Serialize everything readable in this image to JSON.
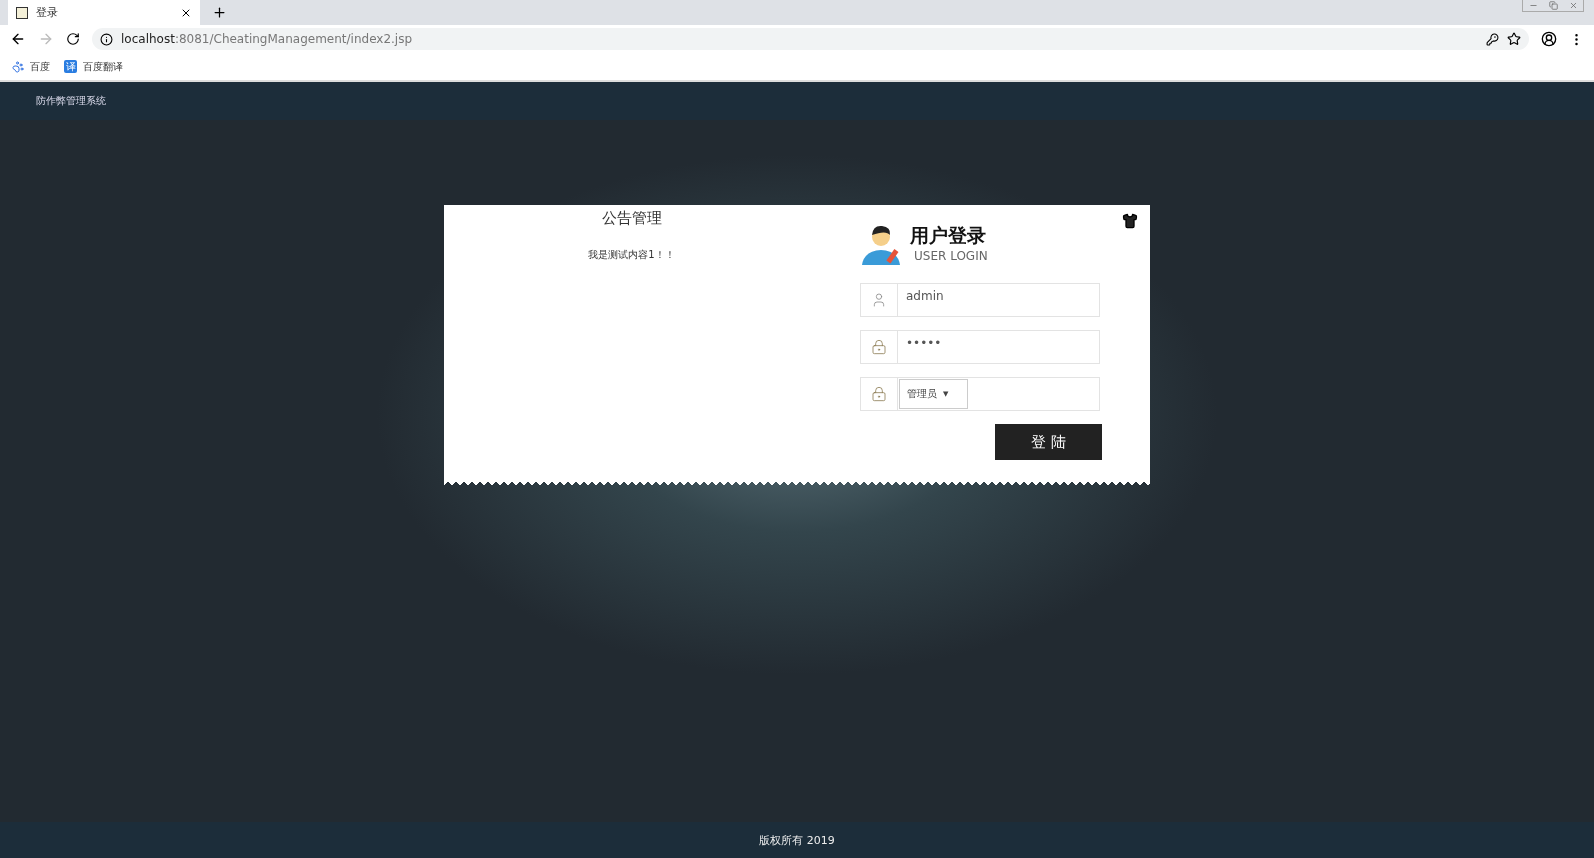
{
  "browser": {
    "tab": {
      "title": "登录"
    },
    "url": {
      "host": "localhost",
      "rest": ":8081/CheatingManagement/index2.jsp"
    },
    "bookmarks": [
      {
        "label": "百度",
        "kind": "paw"
      },
      {
        "label": "百度翻译",
        "kind": "translate",
        "badge": "译"
      }
    ]
  },
  "header": {
    "title": "防作弊管理系统"
  },
  "notice": {
    "title": "公告管理",
    "text": "我是测试内容1！！"
  },
  "login": {
    "title": "用户登录",
    "subtitle": "USER LOGIN",
    "fields": [
      {
        "kind": "username",
        "value": "admin"
      },
      {
        "kind": "password",
        "value": "•••••"
      },
      {
        "kind": "role",
        "value": "管理员",
        "caret": "▼"
      }
    ],
    "button": "登 陆"
  },
  "footer": {
    "text": "版权所有 2019"
  }
}
